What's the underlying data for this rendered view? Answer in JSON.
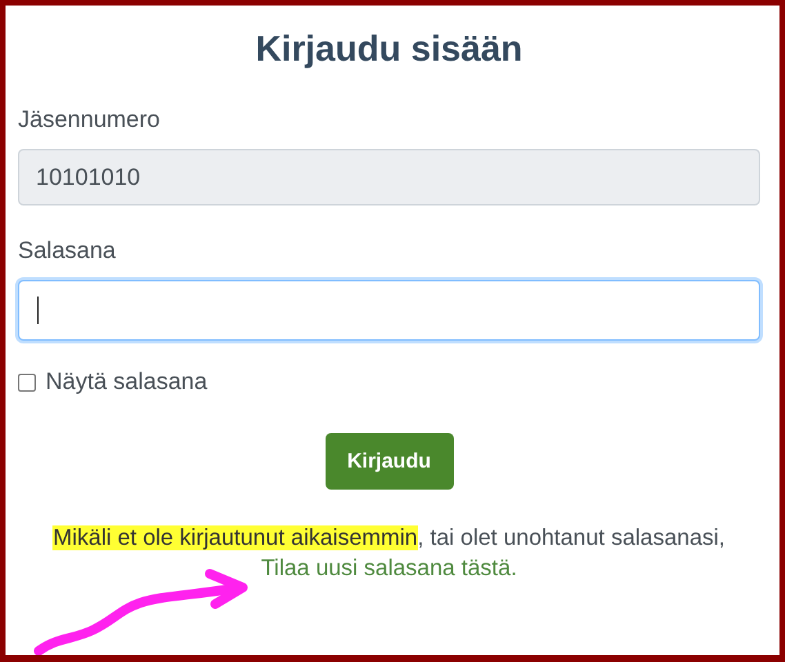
{
  "title": "Kirjaudu sisään",
  "fields": [
    {
      "label": "Jäsennumero",
      "value": "10101010",
      "readonly": true,
      "focused": false
    },
    {
      "label": "Salasana",
      "readonly": false,
      "focused": true
    }
  ],
  "show_password": {
    "label": "Näytä salasana",
    "checked": false
  },
  "submit_button": "Kirjaudu",
  "notice": {
    "highlighted": "Mikäli et ole kirjautunut aikaisemmin",
    "text": ", tai olet unohtanut salasanasi,",
    "link": "Tilaa uusi salasana tästä."
  }
}
